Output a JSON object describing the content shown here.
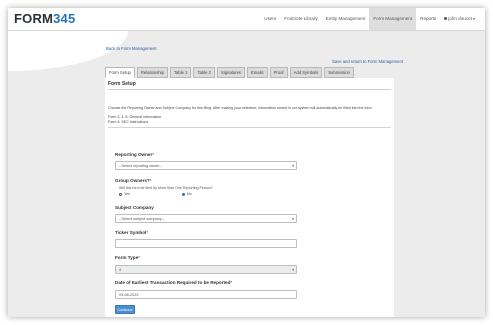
{
  "logo": {
    "part1": "FORM",
    "part2": "345"
  },
  "nav": {
    "items": [
      "Users",
      "Footnote Library",
      "Entity Management",
      "Form Management",
      "Reports"
    ],
    "user": "john doucet"
  },
  "links": {
    "back": "Back to Form Management",
    "save": "Save and return to Form Management"
  },
  "tabs": [
    "Form Setup",
    "Relationship",
    "Table 1",
    "Table 2",
    "Signatures",
    "Emails",
    "Proof",
    "Add Symbols",
    "Submission"
  ],
  "panel": {
    "title": "Form Setup",
    "description": "Choose the Reporting Owner and Subject Company for this filing. After making your selection, information stored in our system will automatically be filled into the form.",
    "note1": "Form 3, 4, 5: General Information",
    "note2": "Form 4: SEC Instructions"
  },
  "form": {
    "reporting_owner": {
      "label": "Reporting Owner",
      "value": "--Select reporting owner--"
    },
    "group_owners": {
      "label": "Group Owners?",
      "question": "Will this form be filed by More than One Reporting Person?",
      "yes": "Yes",
      "no": "No"
    },
    "subject_company": {
      "label": "Subject Company",
      "value": "--Select subject company--"
    },
    "ticker_symbol": {
      "label": "Ticker Symbol",
      "value": ""
    },
    "form_type": {
      "label": "Form Type",
      "value": "4"
    },
    "date": {
      "label": "Date of Earliest Transaction Required to be Reported",
      "value": "09-08-2023"
    },
    "continue": "Continue"
  },
  "colors": {
    "accent": "#2a72b8",
    "button": "#4a8fce",
    "required": "#d9534f"
  }
}
